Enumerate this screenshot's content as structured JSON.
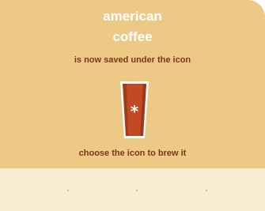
{
  "title": {
    "line1": "american",
    "line2": "coffee"
  },
  "subtitle": "is now saved under the icon",
  "icon": {
    "name": "coffee-cup-icon",
    "glyph": "*"
  },
  "instruction": "choose the icon to brew it",
  "colors": {
    "background": "#edc986",
    "title_text": "#ffffff",
    "body_text": "#7b3516",
    "cup": "#b8451f",
    "cup_dark": "#8c2d15",
    "bottom_bar": "#f8edd2"
  }
}
